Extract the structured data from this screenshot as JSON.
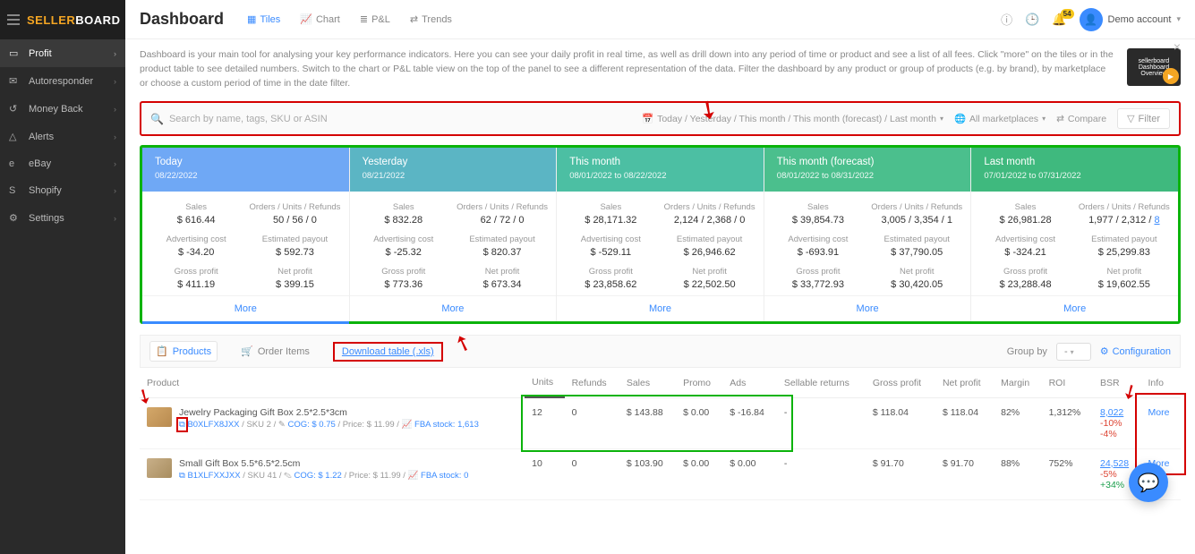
{
  "brand": {
    "pre": "SELLER",
    "post": "BOARD"
  },
  "sidebar": {
    "items": [
      {
        "icon": "▭",
        "label": "Profit",
        "active": true
      },
      {
        "icon": "✉",
        "label": "Autoresponder"
      },
      {
        "icon": "↺",
        "label": "Money Back"
      },
      {
        "icon": "△",
        "label": "Alerts"
      },
      {
        "icon": "e",
        "label": "eBay"
      },
      {
        "icon": "S",
        "label": "Shopify"
      },
      {
        "icon": "⚙",
        "label": "Settings"
      }
    ]
  },
  "header": {
    "title": "Dashboard",
    "tabs": [
      {
        "icon": "▦",
        "label": "Tiles",
        "active": true
      },
      {
        "icon": "📈",
        "label": "Chart"
      },
      {
        "icon": "≣",
        "label": "P&L"
      },
      {
        "icon": "⇄",
        "label": "Trends"
      }
    ],
    "bell_count": "54",
    "account": "Demo account"
  },
  "banner": {
    "text": "Dashboard is your main tool for analysing your key performance indicators. Here you can see your daily profit in real time, as well as drill down into any period of time or product and see a list of all fees. Click \"more\" on the tiles or in the product table to see detailed numbers. Switch to the chart or P&L table view on the top of the panel to see a different representation of the data. Filter the dashboard by any product or group of products (e.g. by brand), by marketplace or choose a custom period of time in the date filter.",
    "thumb": "sellerboard Dashboard Overview"
  },
  "filterbar": {
    "search_placeholder": "Search by name, tags, SKU or ASIN",
    "date_label": "Today / Yesterday / This month / This month (forecast) / Last month",
    "marketplaces": "All marketplaces",
    "compare": "Compare",
    "filter": "Filter"
  },
  "tiles": [
    {
      "title": "Today",
      "date": "08/22/2022",
      "sales": "$ 616.44",
      "orders": "50 / 56 / 0",
      "adv": "$ -34.20",
      "payout": "$ 592.73",
      "gross": "$ 411.19",
      "net": "$ 399.15"
    },
    {
      "title": "Yesterday",
      "date": "08/21/2022",
      "sales": "$ 832.28",
      "orders": "62 / 72 / 0",
      "adv": "$ -25.32",
      "payout": "$ 820.37",
      "gross": "$ 773.36",
      "net": "$ 673.34"
    },
    {
      "title": "This month",
      "date": "08/01/2022 to 08/22/2022",
      "sales": "$ 28,171.32",
      "orders": "2,124 / 2,368 / 0",
      "adv": "$ -529.11",
      "payout": "$ 26,946.62",
      "gross": "$ 23,858.62",
      "net": "$ 22,502.50"
    },
    {
      "title": "This month (forecast)",
      "date": "08/01/2022 to 08/31/2022",
      "sales": "$ 39,854.73",
      "orders": "3,005 / 3,354 / 1",
      "adv": "$ -693.91",
      "payout": "$ 37,790.05",
      "gross": "$ 33,772.93",
      "net": "$ 30,420.05"
    },
    {
      "title": "Last month",
      "date": "07/01/2022 to 07/31/2022",
      "sales": "$ 26,981.28",
      "orders_pre": "1,977 / 2,312 / ",
      "orders_link": "8",
      "adv": "$ -324.21",
      "payout": "$ 25,299.83",
      "gross": "$ 23,288.48",
      "net": "$ 19,602.55"
    }
  ],
  "tile_labels": {
    "sales": "Sales",
    "orders": "Orders / Units / Refunds",
    "adv": "Advertising cost",
    "payout": "Estimated payout",
    "gross": "Gross profit",
    "net": "Net profit",
    "more": "More"
  },
  "table_tabs": {
    "products": "Products",
    "order_items": "Order Items",
    "download": "Download table (.xls)",
    "groupby_label": "Group by",
    "groupby_value": "-",
    "config": "Configuration"
  },
  "columns": [
    "Product",
    "Units",
    "Refunds",
    "Sales",
    "Promo",
    "Ads",
    "Sellable returns",
    "Gross profit",
    "Net profit",
    "Margin",
    "ROI",
    "BSR",
    "Info"
  ],
  "rows": [
    {
      "name": "Jewelry Packaging Gift Box 2.5*2.5*3cm",
      "asin": "B0XLFX8JXX",
      "sku": "SKU 2",
      "cog": "COG: $ 0.75",
      "price": "Price: $ 11.99",
      "fba": "FBA stock: 1,613",
      "units": "12",
      "refunds": "0",
      "sales": "$ 143.88",
      "promo": "$ 0.00",
      "ads": "$ -16.84",
      "ret": "-",
      "gross": "$ 118.04",
      "net": "$ 118.04",
      "margin": "82%",
      "roi": "1,312%",
      "bsr": "8,022",
      "bsr_d1": "-10%",
      "bsr_d2": "-4%",
      "info": "More"
    },
    {
      "name": "Small Gift Box 5.5*6.5*2.5cm",
      "asin": "B1XLFXXJXX",
      "sku": "SKU 41",
      "cog": "COG: $ 1.22",
      "price": "Price: $ 11.99",
      "fba": "FBA stock: 0",
      "units": "10",
      "refunds": "0",
      "sales": "$ 103.90",
      "promo": "$ 0.00",
      "ads": "$ 0.00",
      "ret": "-",
      "gross": "$ 91.70",
      "net": "$ 91.70",
      "margin": "88%",
      "roi": "752%",
      "bsr": "24,528",
      "bsr_d1": "-5%",
      "bsr_d2": "+34%",
      "info": "More"
    }
  ]
}
